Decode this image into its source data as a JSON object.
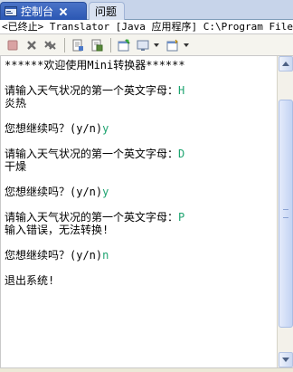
{
  "tabs": [
    {
      "label": "控制台",
      "icon": "console-icon",
      "active": true
    },
    {
      "label": "问题",
      "active": false
    }
  ],
  "console_title": "<已终止> Translator [Java 应用程序] C:\\Program Files\\",
  "toolbar": {
    "icons": [
      "terminate-icon",
      "remove-launch-icon",
      "remove-all-icon",
      "clear-console-icon",
      "scroll-lock-icon",
      "pin-console-icon",
      "display-console-icon",
      "open-console-icon"
    ]
  },
  "console_lines": [
    {
      "text": "******欢迎使用Mini转换器******",
      "input": ""
    },
    {
      "text": "",
      "input": ""
    },
    {
      "text": "请输入天气状况的第一个英文字母：",
      "input": "H"
    },
    {
      "text": "炎热",
      "input": ""
    },
    {
      "text": "",
      "input": ""
    },
    {
      "text": "您想继续吗？(y/n)",
      "input": "y"
    },
    {
      "text": "",
      "input": ""
    },
    {
      "text": "请输入天气状况的第一个英文字母：",
      "input": "D"
    },
    {
      "text": "干燥",
      "input": ""
    },
    {
      "text": "",
      "input": ""
    },
    {
      "text": "您想继续吗？(y/n)",
      "input": "y"
    },
    {
      "text": "",
      "input": ""
    },
    {
      "text": "请输入天气状况的第一个英文字母：",
      "input": "P"
    },
    {
      "text": "输入错误，无法转换!",
      "input": ""
    },
    {
      "text": "",
      "input": ""
    },
    {
      "text": "您想继续吗？(y/n)",
      "input": "n"
    },
    {
      "text": "",
      "input": ""
    },
    {
      "text": "退出系统!",
      "input": ""
    }
  ],
  "colors": {
    "input_text": "#1ca36f",
    "active_tab": "#2b57b3"
  }
}
